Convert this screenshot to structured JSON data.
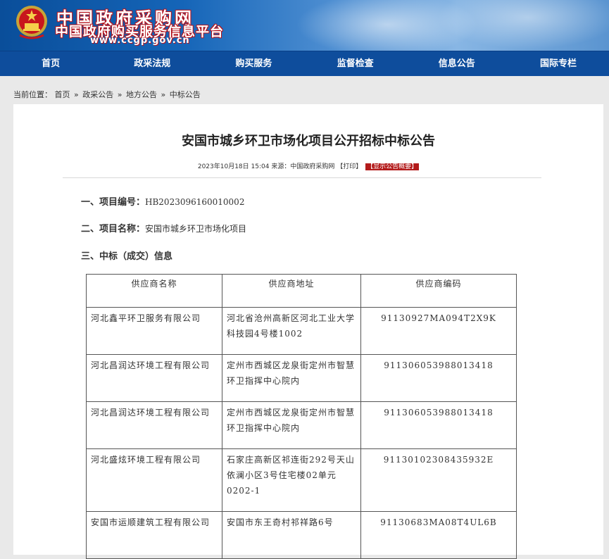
{
  "header": {
    "site_name": "中国政府采购网",
    "site_subname": "中国政府购买服务信息平台",
    "site_url": "www.ccgp.gov.cn",
    "colors": {
      "nav_bg": "#0e4d9c",
      "accent_red": "#b31b1b"
    }
  },
  "nav": {
    "items": [
      "首页",
      "政采法规",
      "购买服务",
      "监督检查",
      "信息公告",
      "国际专栏"
    ]
  },
  "breadcrumb": {
    "prefix": "当前位置：",
    "items": [
      "首页",
      "政采公告",
      "地方公告",
      "中标公告"
    ],
    "separator": "»"
  },
  "article": {
    "title": "安国市城乡环卫市场化项目公开招标中标公告",
    "date": "2023年10月18日 15:04",
    "source_label": "来源：",
    "source": "中国政府采购网",
    "print_label": "【打印】",
    "summary_label": "【显示公告概要】",
    "sections": {
      "s1_label": "一、项目编号：",
      "s1_value": "HB2023096160010002",
      "s2_label": "二、项目名称：",
      "s2_value": "安国市城乡环卫市场化项目",
      "s3_label": "三、中标（成交）信息"
    },
    "table": {
      "headers": [
        "供应商名称",
        "供应商地址",
        "供应商编码"
      ],
      "rows": [
        [
          "河北鑫平环卫服务有限公司",
          "河北省沧州高新区河北工业大学科技园4号楼1002",
          "91130927MA094T2X9K"
        ],
        [
          "河北昌润达环境工程有限公司",
          "定州市西城区龙泉街定州市智慧环卫指挥中心院内",
          "911306053988013418"
        ],
        [
          "河北昌润达环境工程有限公司",
          "定州市西城区龙泉街定州市智慧环卫指挥中心院内",
          "911306053988013418"
        ],
        [
          "河北盛炫环境工程有限公司",
          "石家庄高新区祁连街292号天山依澜小区3号住宅楼02单元0202-1",
          "91130102308435932E"
        ],
        [
          "安国市运顺建筑工程有限公司",
          "安国市东王奇村祁祥路6号",
          "91130683MA08T4UL6B"
        ]
      ]
    }
  }
}
